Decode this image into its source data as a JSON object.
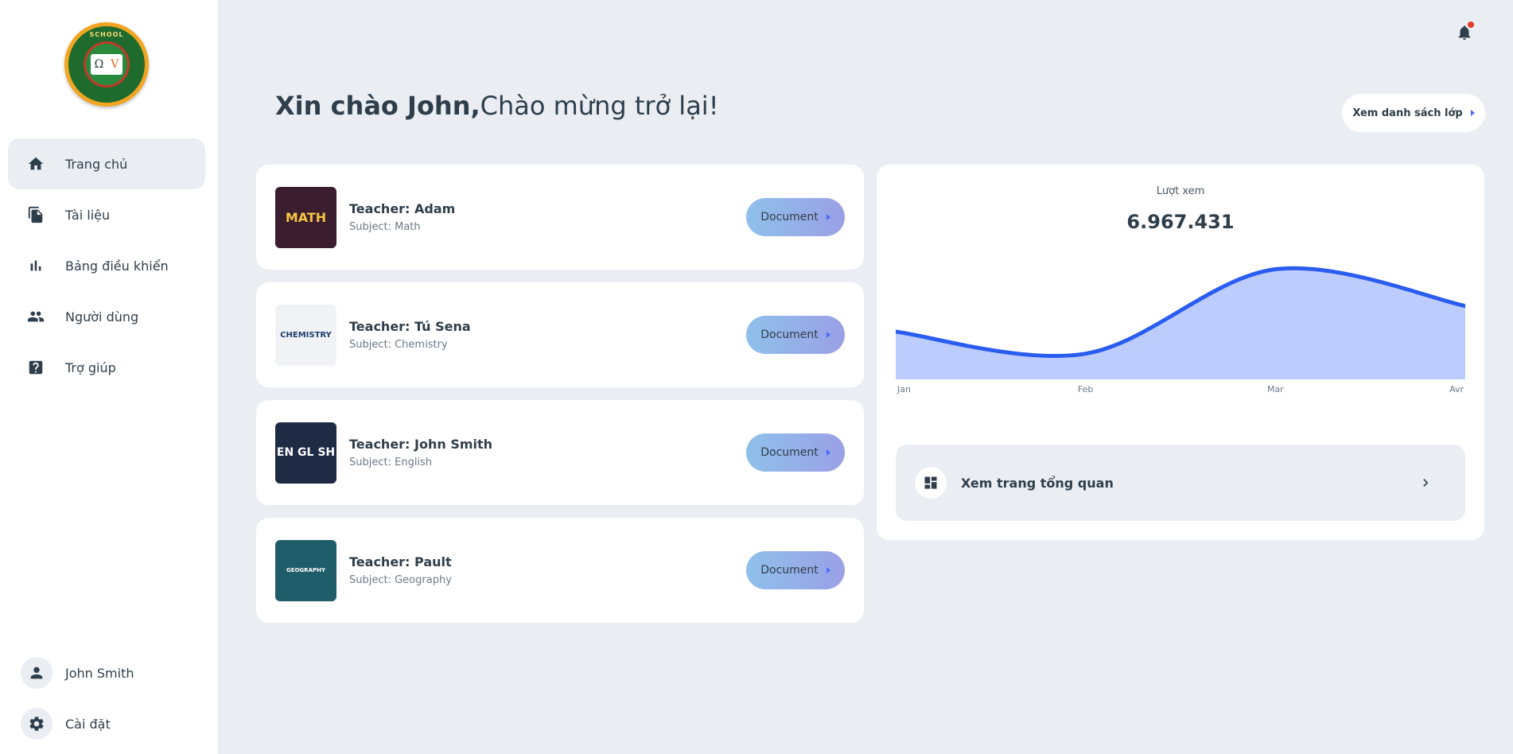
{
  "sidebar": {
    "logo_text": "SCHOOL",
    "logo_glyphs": [
      "Ω",
      "V"
    ],
    "items": [
      {
        "label": "Trang chủ",
        "icon": "home-icon",
        "active": true
      },
      {
        "label": "Tài liệu",
        "icon": "documents-icon",
        "active": false
      },
      {
        "label": "Bảng điều khiển",
        "icon": "bar-chart-icon",
        "active": false
      },
      {
        "label": "Người dùng",
        "icon": "users-icon",
        "active": false
      },
      {
        "label": "Trợ giúp",
        "icon": "help-icon",
        "active": false
      }
    ],
    "user_name": "John Smith",
    "settings_label": "Cài đặt"
  },
  "header": {
    "greeting_bold": "Xin chào John,",
    "greeting_rest": "Chào mừng trở lại!",
    "class_list_button": "Xem danh sách lớp"
  },
  "teachers": [
    {
      "teacher": "Teacher: Adam",
      "subject": "Subject: Math",
      "thumb_text": "MATH",
      "button": "Document"
    },
    {
      "teacher": "Teacher: Tú Sena",
      "subject": "Subject: Chemistry",
      "thumb_text": "CHEMISTRY",
      "button": "Document"
    },
    {
      "teacher": "Teacher: John Smith",
      "subject": "Subject: English",
      "thumb_text": "EN GL SH",
      "button": "Document"
    },
    {
      "teacher": "Teacher: Pault",
      "subject": "Subject: Geography",
      "thumb_text": "GEOGRAPHY",
      "button": "Document"
    }
  ],
  "stats": {
    "label": "Lượt xem",
    "value": "6.967.431"
  },
  "chart_data": {
    "type": "area",
    "categories": [
      "Jan",
      "Feb",
      "Mar",
      "Avr"
    ],
    "x_positions": [
      0,
      1,
      2,
      3
    ],
    "curve": [
      {
        "x": 0,
        "y": 52
      },
      {
        "x": 1,
        "y": 28
      },
      {
        "x": 2,
        "y": 120
      },
      {
        "x": 3,
        "y": 80
      }
    ],
    "ylim": [
      0,
      130
    ],
    "title": "",
    "xlabel": "",
    "ylabel": "",
    "line_color": "#2b5cf0",
    "fill_color": "#bccdfd"
  },
  "overview": {
    "label": "Xem trang tổng quan"
  },
  "colors": {
    "background": "#eaeef2",
    "accent": "#4a6cf7",
    "notification_dot": "#e53b2c"
  }
}
